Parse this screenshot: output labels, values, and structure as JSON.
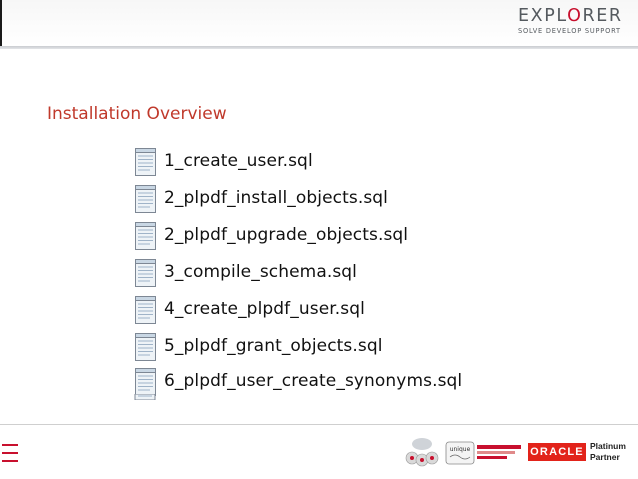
{
  "header": {
    "logo_text_part1": "EXPL",
    "logo_text_accent": "O",
    "logo_text_part2": "RER",
    "logo_tagline": "SOLVE  DEVELOP  SUPPORT",
    "logo_text_full": "EXPLORER"
  },
  "slide": {
    "title": "Installation Overview"
  },
  "files": [
    "1_create_user.sql",
    "2_plpdf_install_objects.sql",
    "2_plpdf_upgrade_objects.sql",
    "3_compile_schema.sql",
    "4_create_plpdf_user.sql",
    "5_plpdf_grant_objects.sql",
    "6_plpdf_user_create_synonyms.sql"
  ],
  "footer": {
    "oracle_logo": "ORACLE",
    "partner_line1": "Platinum",
    "partner_line2": "Partner",
    "badge_text": "unique"
  },
  "colors": {
    "accent_red": "#c8102e",
    "title_red": "#c0392b",
    "oracle_red": "#e2231a",
    "logo_grey": "#555a5f"
  },
  "icons": {
    "file": "text-file-icon",
    "menu": "hamburger-menu-icon"
  }
}
